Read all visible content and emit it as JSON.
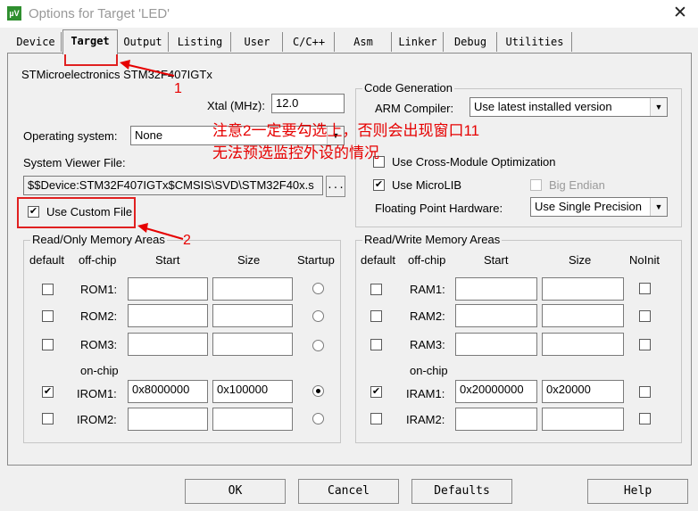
{
  "window": {
    "title": "Options for Target 'LED'",
    "close_glyph": "✕",
    "icon": "uvision-app-icon",
    "icon_glyph": "µV"
  },
  "tabs": [
    "Device",
    "Target",
    "Output",
    "Listing",
    "User",
    "C/C++",
    "Asm",
    "Linker",
    "Debug",
    "Utilities"
  ],
  "active_tab": "Target",
  "device_name": "STMicroelectronics STM32F407IGTx",
  "xtal": {
    "label": "Xtal (MHz):",
    "value": "12.0"
  },
  "operating_system": {
    "label": "Operating system:",
    "value": "None"
  },
  "system_viewer": {
    "label": "System Viewer File:",
    "value": "$$Device:STM32F407IGTx$CMSIS\\SVD\\STM32F40x.s",
    "browse": "...",
    "use_custom_label": "Use Custom File",
    "use_custom_checked": true
  },
  "code_generation": {
    "title": "Code Generation",
    "arm_compiler_label": "ARM Compiler:",
    "arm_compiler_value": "Use latest installed version",
    "cross_module_label": "Use Cross-Module Optimization",
    "cross_module_checked": false,
    "microlib_label": "Use MicroLIB",
    "microlib_checked": true,
    "big_endian_label": "Big Endian",
    "big_endian_checked": false,
    "fph_label": "Floating Point Hardware:",
    "fph_value": "Use Single Precision"
  },
  "ro_memory": {
    "title": "Read/Only Memory Areas",
    "headers": {
      "default": "default",
      "offchip": "off-chip",
      "start": "Start",
      "size": "Size",
      "startup": "Startup"
    },
    "onchip_label": "on-chip",
    "rows": [
      {
        "name": "ROM1:",
        "default": false,
        "start": "",
        "size": "",
        "startup": false
      },
      {
        "name": "ROM2:",
        "default": false,
        "start": "",
        "size": "",
        "startup": false
      },
      {
        "name": "ROM3:",
        "default": false,
        "start": "",
        "size": "",
        "startup": false
      },
      {
        "name": "IROM1:",
        "default": true,
        "start": "0x8000000",
        "size": "0x100000",
        "startup": true
      },
      {
        "name": "IROM2:",
        "default": false,
        "start": "",
        "size": "",
        "startup": false
      }
    ]
  },
  "rw_memory": {
    "title": "Read/Write Memory Areas",
    "headers": {
      "default": "default",
      "offchip": "off-chip",
      "start": "Start",
      "size": "Size",
      "noinit": "NoInit"
    },
    "onchip_label": "on-chip",
    "rows": [
      {
        "name": "RAM1:",
        "default": false,
        "start": "",
        "size": "",
        "noinit": false
      },
      {
        "name": "RAM2:",
        "default": false,
        "start": "",
        "size": "",
        "noinit": false
      },
      {
        "name": "RAM3:",
        "default": false,
        "start": "",
        "size": "",
        "noinit": false
      },
      {
        "name": "IRAM1:",
        "default": true,
        "start": "0x20000000",
        "size": "0x20000",
        "noinit": false
      },
      {
        "name": "IRAM2:",
        "default": false,
        "start": "",
        "size": "",
        "noinit": false
      }
    ]
  },
  "buttons": {
    "ok": "OK",
    "cancel": "Cancel",
    "defaults": "Defaults",
    "help": "Help"
  },
  "annotations": {
    "marker1": "1",
    "marker2": "2",
    "note_line1": "注意2一定要勾选上，否则会出现窗口11",
    "note_line2": "无法预选监控外设的情况",
    "color": "#e60000"
  }
}
